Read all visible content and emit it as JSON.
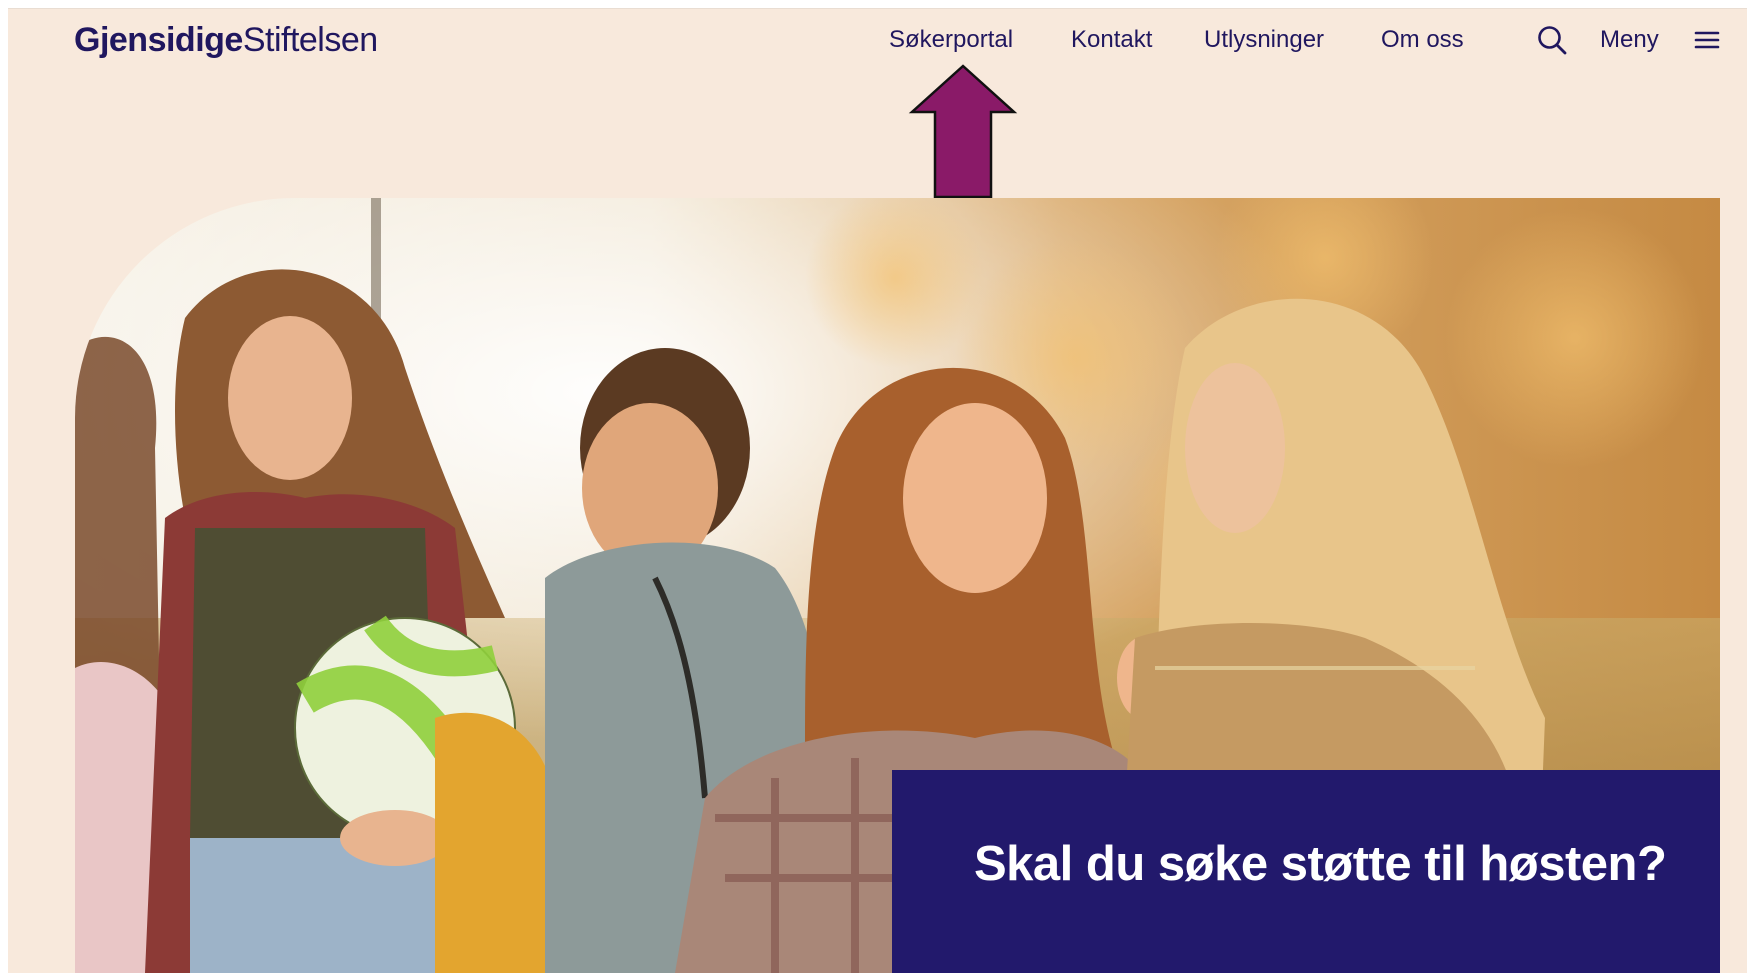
{
  "header": {
    "logo_bold": "Gjensidige",
    "logo_light": "Stiftelsen",
    "nav": [
      "Søkerportal",
      "Kontakt",
      "Utlysninger",
      "Om oss"
    ],
    "menu_label": "Meny"
  },
  "hero": {
    "headline": "Skal du søke støtte til høsten?"
  },
  "colors": {
    "page_background": "#f8e9dc",
    "brand_navy": "#20175f",
    "headline_box": "#22196c",
    "annotation_arrow": "#8a1a68"
  },
  "icons": {
    "search": "search-icon",
    "menu": "hamburger-menu-icon",
    "annotation": "up-arrow-icon"
  }
}
